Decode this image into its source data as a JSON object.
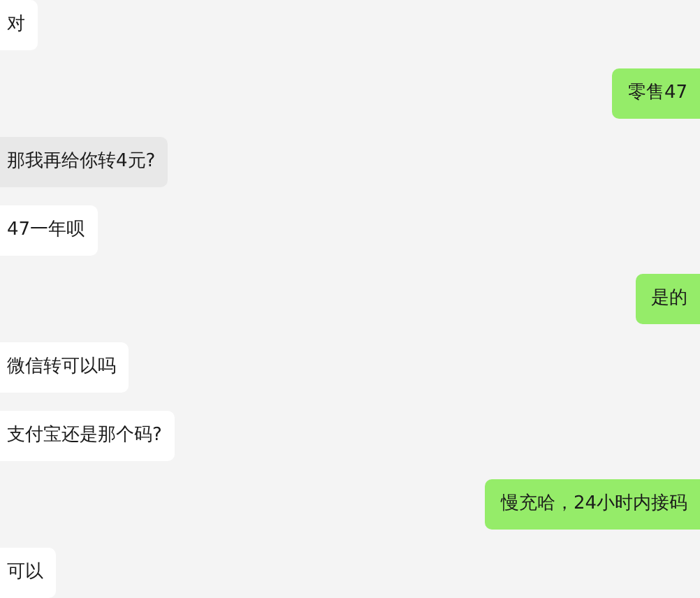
{
  "messages": [
    {
      "kind": "incoming",
      "text": "对",
      "selected": false
    },
    {
      "kind": "outgoing",
      "text": "零售47",
      "selected": false
    },
    {
      "kind": "incoming",
      "text": "那我再给你转4元?",
      "selected": true
    },
    {
      "kind": "incoming",
      "text": "47一年呗",
      "selected": false
    },
    {
      "kind": "outgoing",
      "text": "是的",
      "selected": false
    },
    {
      "kind": "incoming",
      "text": "微信转可以吗",
      "selected": false
    },
    {
      "kind": "incoming",
      "text": "支付宝还是那个码?",
      "selected": false
    },
    {
      "kind": "outgoing",
      "text": "慢充哈，24小时内接码",
      "selected": false
    },
    {
      "kind": "incoming",
      "text": "可以",
      "selected": false
    }
  ]
}
